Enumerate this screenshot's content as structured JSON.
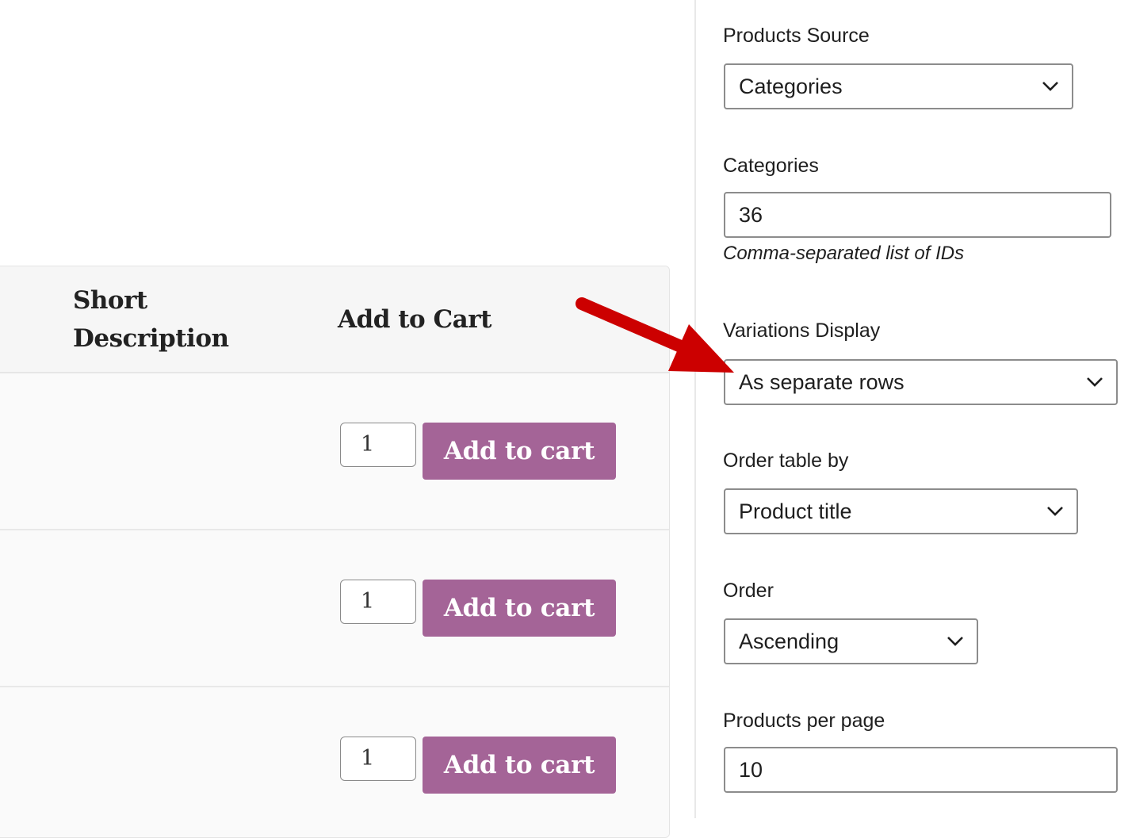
{
  "table": {
    "columns": [
      "Short Description",
      "Add to Cart"
    ],
    "header_short_desc_line1": "Short",
    "header_short_desc_line2": "Description",
    "header_add_to_cart": "Add to Cart",
    "rows": [
      {
        "quantity": "1",
        "button_label": "Add to cart"
      },
      {
        "quantity": "1",
        "button_label": "Add to cart"
      },
      {
        "quantity": "1",
        "button_label": "Add to cart"
      }
    ]
  },
  "settings": {
    "products_source": {
      "label": "Products Source",
      "value": "Categories"
    },
    "categories": {
      "label": "Categories",
      "value": "36",
      "help": "Comma-separated list of IDs"
    },
    "variations_display": {
      "label": "Variations Display",
      "value": "As separate rows"
    },
    "order_table_by": {
      "label": "Order table by",
      "value": "Product title"
    },
    "order": {
      "label": "Order",
      "value": "Ascending"
    },
    "products_per_page": {
      "label": "Products per page",
      "value": "10"
    }
  },
  "colors": {
    "button": "#a46497",
    "annotation_arrow": "#cc0000"
  },
  "annotation": {
    "icon": "arrow-icon",
    "points_to": "Variations Display"
  }
}
